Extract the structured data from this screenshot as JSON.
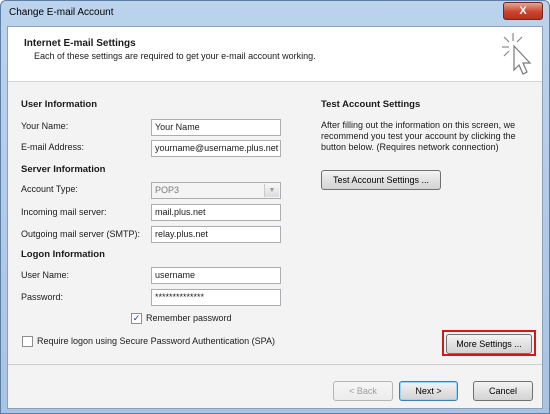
{
  "window": {
    "title": "Change E-mail Account",
    "close_label": "X"
  },
  "header": {
    "title": "Internet E-mail Settings",
    "subtitle": "Each of these settings are required to get your e-mail account working.",
    "icon": "pointer-sparkle-icon"
  },
  "user_info": {
    "section": "User Information",
    "name_label": "Your Name:",
    "name_value": "Your Name",
    "email_label": "E-mail Address:",
    "email_value": "yourname@username.plus.net"
  },
  "server_info": {
    "section": "Server Information",
    "account_type_label": "Account Type:",
    "account_type_value": "POP3",
    "incoming_label": "Incoming mail server:",
    "incoming_value": "mail.plus.net",
    "outgoing_label": "Outgoing mail server (SMTP):",
    "outgoing_value": "relay.plus.net"
  },
  "logon_info": {
    "section": "Logon Information",
    "username_label": "User Name:",
    "username_value": "username",
    "password_label": "Password:",
    "password_value": "**************",
    "remember_label": "Remember password",
    "remember_checked": true,
    "spa_label": "Require logon using Secure Password Authentication (SPA)",
    "spa_checked": false
  },
  "test_settings": {
    "section": "Test Account Settings",
    "description": "After filling out the information on this screen, we recommend you test your account by clicking the button below. (Requires network connection)",
    "test_button": "Test Account Settings ..."
  },
  "buttons": {
    "more_settings": "More Settings ...",
    "back": "< Back",
    "next": "Next >",
    "cancel": "Cancel"
  },
  "colors": {
    "highlight": "#d01919",
    "titlebar": "#bcd3ec"
  }
}
